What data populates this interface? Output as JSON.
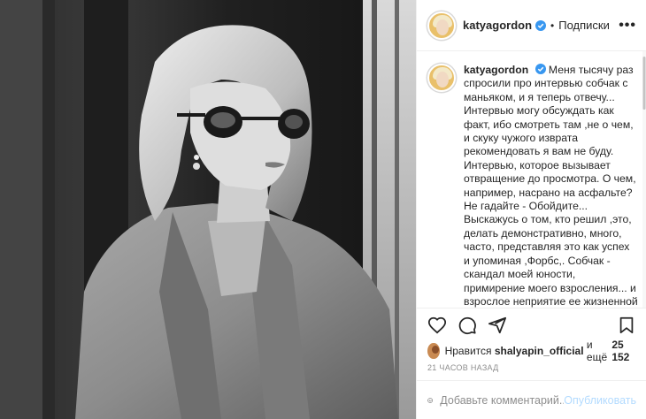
{
  "post": {
    "username": "katyagordon",
    "separator": "•",
    "follow_label": "Подписки",
    "more_label": "•••"
  },
  "caption": {
    "username": "katyagordon",
    "text": "Меня тысячу раз спросили про интервью собчак с маньяком, и я теперь отвечу... Интервью могу обсуждать как факт, ибо смотреть там ,не о чем, и скуку чужого изврата рекомендовать я вам не буду. Интервью, которое вызывает отвращение до просмотра. О чем, например, насрано на асфальте? Не гадайте - Обойдите... Выскажусь о том, кто решил ,это, делать демонстративно, много, часто, представляя это как успех и упоминая ,Форбс,. Собчак - скандал моей юности, примирение моего взросления... и взрослое неприятие ее жизненной позиции сейчас. Собчак - это про бабки. И все. Поэтому маньяк за гонорар и бабки за просмотры... А правда не в"
  },
  "likes": {
    "prefix": "Нравится",
    "user": "shalyapin_official",
    "middle": "и ещё",
    "count": "25 152"
  },
  "timestamp": "21 часов назад",
  "comment_box": {
    "placeholder": "Добавьте комментарий...",
    "publish_label": "Опубликовать"
  },
  "icons": {
    "verified": "verified-badge-icon",
    "like": "heart-icon",
    "comment": "comment-bubble-icon",
    "share": "paper-plane-icon",
    "save": "bookmark-icon",
    "emoji": "smiley-icon"
  },
  "colors": {
    "verified": "#3897f0",
    "publish_disabled": "#b3dbff",
    "muted": "#8e8e8e"
  }
}
